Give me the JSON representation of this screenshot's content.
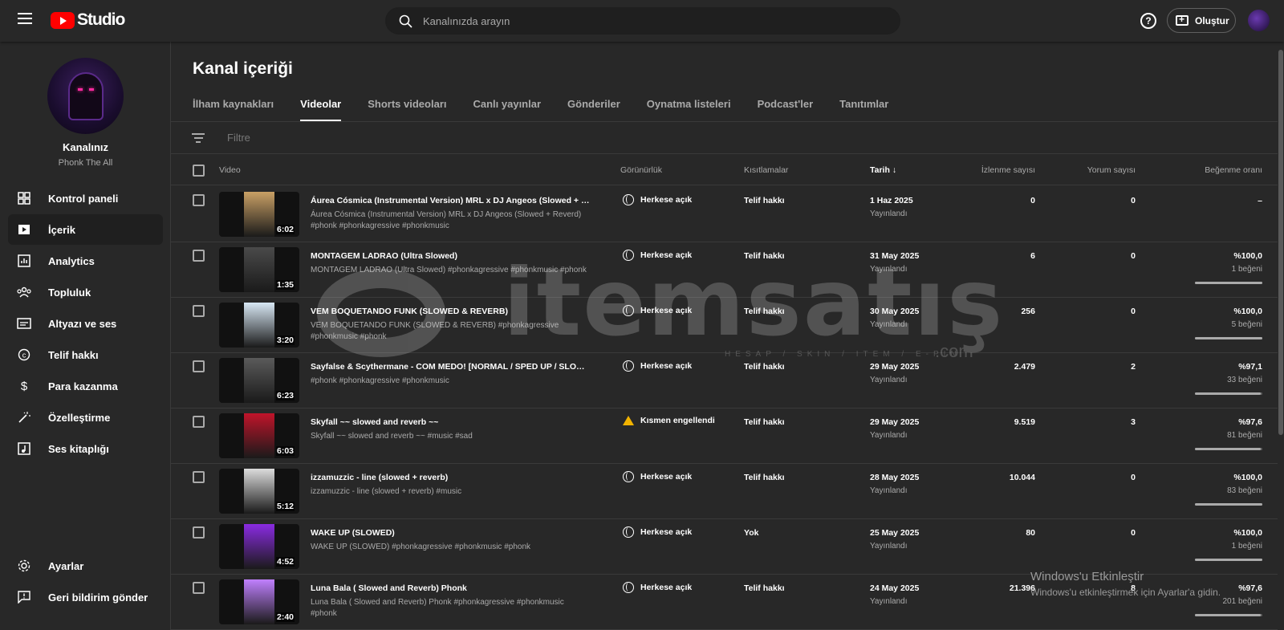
{
  "app": {
    "logo_text": "Studio"
  },
  "search": {
    "placeholder": "Kanalınızda arayın"
  },
  "header": {
    "help_label": "?",
    "create_label": "Oluştur"
  },
  "channel": {
    "name": "Kanalınız",
    "subtitle": "Phonk The All"
  },
  "sidebar": {
    "items": [
      {
        "label": "Kontrol paneli",
        "icon": "dashboard-icon"
      },
      {
        "label": "İçerik",
        "icon": "content-icon"
      },
      {
        "label": "Analytics",
        "icon": "analytics-icon"
      },
      {
        "label": "Topluluk",
        "icon": "community-icon"
      },
      {
        "label": "Altyazı ve ses",
        "icon": "subtitles-icon"
      },
      {
        "label": "Telif hakkı",
        "icon": "copyright-icon"
      },
      {
        "label": "Para kazanma",
        "icon": "dollar-icon"
      },
      {
        "label": "Özelleştirme",
        "icon": "customization-icon"
      },
      {
        "label": "Ses kitaplığı",
        "icon": "audio-library-icon"
      }
    ],
    "bottom": [
      {
        "label": "Ayarlar",
        "icon": "gear-icon"
      },
      {
        "label": "Geri bildirim gönder",
        "icon": "feedback-icon"
      }
    ]
  },
  "main": {
    "title": "Kanal içeriği",
    "tabs": [
      "İlham kaynakları",
      "Videolar",
      "Shorts videoları",
      "Canlı yayınlar",
      "Gönderiler",
      "Oynatma listeleri",
      "Podcast'ler",
      "Tanıtımlar"
    ],
    "active_tab": "Videolar",
    "filter_placeholder": "Filtre",
    "columns": {
      "video": "Video",
      "visibility": "Görünürlük",
      "restrictions": "Kısıtlamalar",
      "date": "Tarih",
      "date_sort": "↓",
      "views": "İzlenme sayısı",
      "comments": "Yorum sayısı",
      "like_rate": "Beğenme oranı"
    },
    "videos": [
      {
        "title": "Áurea Cósmica (Instrumental Version) MRL x DJ Angeos (Slowed + Rev...",
        "desc": "Áurea Cósmica (Instrumental Version) MRL x DJ Angeos (Slowed + Reverd) #phonk #phonkagressive #phonkmusic",
        "duration": "6:02",
        "visibility": "Herkese açık",
        "restriction": "Telif hakkı",
        "date": "1 Haz 2025",
        "status": "Yayınlandı",
        "views": "0",
        "comments": "0",
        "rate": "–",
        "likes": "",
        "like_fraction": null,
        "thumb_color": "#c9a065"
      },
      {
        "title": "MONTAGEM LADRAO (Ultra Slowed)",
        "desc": "MONTAGEM LADRAO (Ultra Slowed) #phonkagressive #phonkmusic #phonk",
        "duration": "1:35",
        "visibility": "Herkese açık",
        "restriction": "Telif hakkı",
        "date": "31 May 2025",
        "status": "Yayınlandı",
        "views": "6",
        "comments": "0",
        "rate": "%100,0",
        "likes": "1 beğeni",
        "like_fraction": 1.0,
        "thumb_color": "#4a4a4a"
      },
      {
        "title": "VEM BOQUETANDO FUNK (SLOWED & REVERB)",
        "desc": "VEM BOQUETANDO FUNK (SLOWED & REVERB) #phonkagressive #phonkmusic #phonk",
        "duration": "3:20",
        "visibility": "Herkese açık",
        "restriction": "Telif hakkı",
        "date": "30 May 2025",
        "status": "Yayınlandı",
        "views": "256",
        "comments": "0",
        "rate": "%100,0",
        "likes": "5 beğeni",
        "like_fraction": 1.0,
        "thumb_color": "#d8e8f5"
      },
      {
        "title": "Sayfalse & Scythermane - COM MEDO! [NORMAL / SPED UP / SLOWED ...",
        "desc": "#phonk #phonkagressive #phonkmusic",
        "duration": "6:23",
        "visibility": "Herkese açık",
        "restriction": "Telif hakkı",
        "date": "29 May 2025",
        "status": "Yayınlandı",
        "views": "2.479",
        "comments": "2",
        "rate": "%97,1",
        "likes": "33 beğeni",
        "like_fraction": 0.971,
        "thumb_color": "#5a5a5a"
      },
      {
        "title": "Skyfall ~~ slowed and reverb ~~",
        "desc": "Skyfall ~~ slowed and reverb ~~ #music #sad",
        "duration": "6:03",
        "visibility": "Kısmen engellendi",
        "restriction": "Telif hakkı",
        "date": "29 May 2025",
        "status": "Yayınlandı",
        "views": "9.519",
        "comments": "3",
        "rate": "%97,6",
        "likes": "81 beğeni",
        "like_fraction": 0.976,
        "thumb_color": "#c0142a",
        "warning": true
      },
      {
        "title": "izzamuzzic - line (slowed + reverb)",
        "desc": "izzamuzzic - line (slowed + reverb) #music",
        "duration": "5:12",
        "visibility": "Herkese açık",
        "restriction": "Telif hakkı",
        "date": "28 May 2025",
        "status": "Yayınlandı",
        "views": "10.044",
        "comments": "0",
        "rate": "%100,0",
        "likes": "83 beğeni",
        "like_fraction": 1.0,
        "thumb_color": "#dcdcdc"
      },
      {
        "title": "WAKE UP (SLOWED)",
        "desc": "WAKE UP (SLOWED) #phonkagressive #phonkmusic #phonk",
        "duration": "4:52",
        "visibility": "Herkese açık",
        "restriction": "Yok",
        "date": "25 May 2025",
        "status": "Yayınlandı",
        "views": "80",
        "comments": "0",
        "rate": "%100,0",
        "likes": "1 beğeni",
        "like_fraction": 1.0,
        "thumb_color": "#8a2be2"
      },
      {
        "title": "Luna Bala ( Slowed and Reverb) Phonk",
        "desc": "Luna Bala ( Slowed and Reverb) Phonk #phonkagressive #phonkmusic #phonk",
        "duration": "2:40",
        "visibility": "Herkese açık",
        "restriction": "Telif hakkı",
        "date": "24 May 2025",
        "status": "Yayınlandı",
        "views": "21.396",
        "comments": "8",
        "rate": "%97,6",
        "likes": "201 beğeni",
        "like_fraction": 0.976,
        "thumb_color": "#c080ff"
      }
    ]
  },
  "watermark": {
    "brand": "itemsatış",
    "tagline": "HESAP / SKIN / ITEM / E-PIN",
    "domain": ".com"
  },
  "activation": {
    "title": "Windows'u Etkinleştir",
    "message": "Windows'u etkinleştirmek için Ayarlar'a gidin."
  }
}
